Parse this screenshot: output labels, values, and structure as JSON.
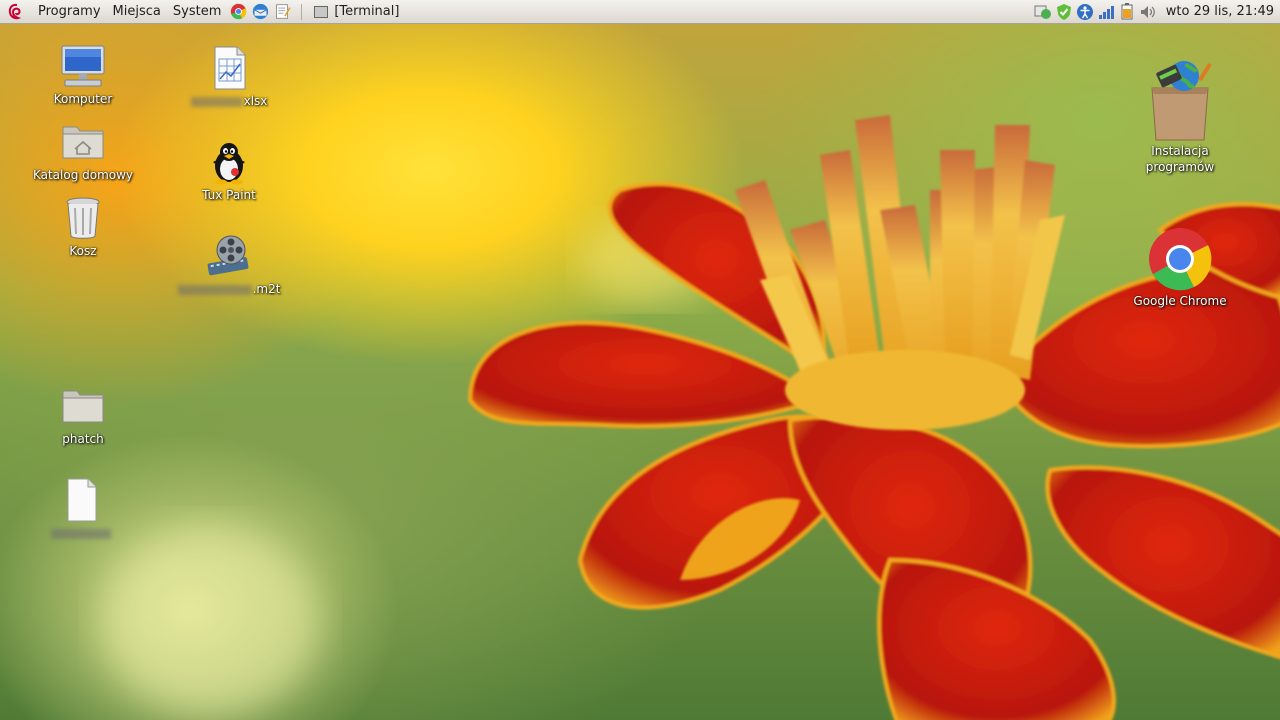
{
  "panel": {
    "menus": [
      "Programy",
      "Miejsca",
      "System"
    ],
    "launchers": [
      "chrome-icon",
      "thunderbird-icon",
      "text-editor-icon"
    ],
    "taskbar": {
      "label": "[Terminal]"
    },
    "tray": [
      "update-notifier-icon",
      "security-check-icon",
      "accessibility-icon",
      "network-signal-icon",
      "battery-icon",
      "volume-icon"
    ],
    "clock": "wto 29 lis, 21:49"
  },
  "desktop": {
    "icons": [
      {
        "name": "computer",
        "label": "Komputer"
      },
      {
        "name": "home-folder",
        "label": "Katalog domowy"
      },
      {
        "name": "trash",
        "label": "Kosz"
      },
      {
        "name": "spreadsheet",
        "label": "xlsx"
      },
      {
        "name": "tux-paint",
        "label": "Tux Paint"
      },
      {
        "name": "video-file",
        "label": ".m2t"
      },
      {
        "name": "phatch-folder",
        "label": "phatch"
      },
      {
        "name": "blank-file",
        "label": ""
      },
      {
        "name": "software-installer",
        "label": "Instalacja\nprogramów"
      },
      {
        "name": "google-chrome",
        "label": "Google Chrome"
      }
    ]
  },
  "colors": {
    "panel_bg": "#e8e5df",
    "petal_red": "#c81a0c",
    "petal_yellow": "#f5b21e"
  }
}
